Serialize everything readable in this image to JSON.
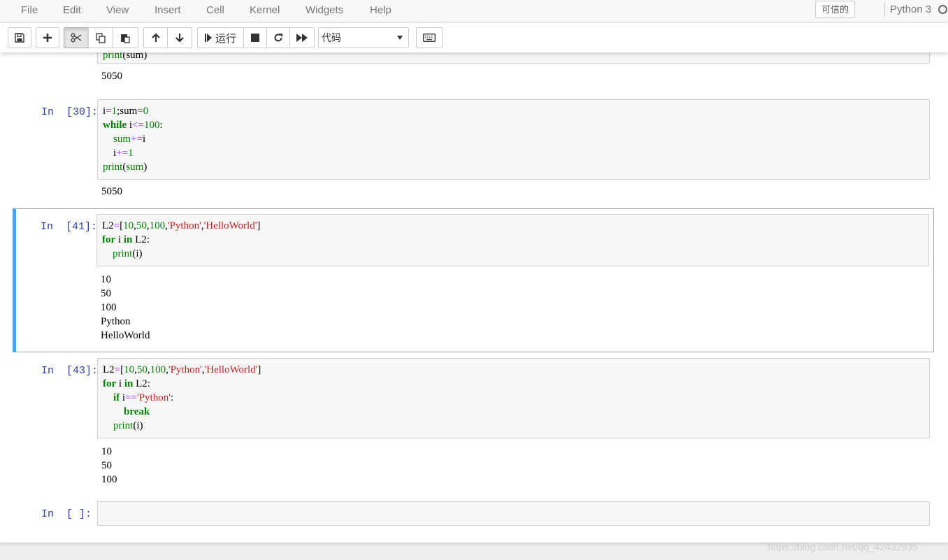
{
  "menu": {
    "items": [
      "File",
      "Edit",
      "View",
      "Insert",
      "Cell",
      "Kernel",
      "Widgets",
      "Help"
    ],
    "trusted": "可信的",
    "kernel": "Python 3"
  },
  "toolbar": {
    "run_label": "运行",
    "cell_type": "代码"
  },
  "cells": [
    {
      "prompt": "",
      "code_visible": "print(sum)",
      "output": "5050"
    },
    {
      "prompt": "In  [30]:",
      "code_lines": [
        "i=1;sum=0",
        "while i<=100:",
        "    sum+=i",
        "    i+=1",
        "print(sum)"
      ],
      "output": "5050"
    },
    {
      "prompt": "In  [41]:",
      "code_lines": [
        "L2=[10,50,100,'Python','HelloWorld']",
        "for i in L2:",
        "    print(i)"
      ],
      "output_lines": [
        "10",
        "50",
        "100",
        "Python",
        "HelloWorld"
      ],
      "selected": true
    },
    {
      "prompt": "In  [43]:",
      "code_lines": [
        "L2=[10,50,100,'Python','HelloWorld']",
        "for i in L2:",
        "    if i=='Python':",
        "        break",
        "    print(i)"
      ],
      "output_lines": [
        "10",
        "50",
        "100"
      ]
    },
    {
      "prompt": "In  [ ]:",
      "code_lines": []
    }
  ],
  "watermark": "https://blog.csdn.net/qq_42432935",
  "colors": {
    "selected_cell_bar": "#42a5f5",
    "prompt": "#303f9f",
    "keyword": "#008000",
    "operator": "#aa22ff",
    "string": "#ba2121"
  }
}
